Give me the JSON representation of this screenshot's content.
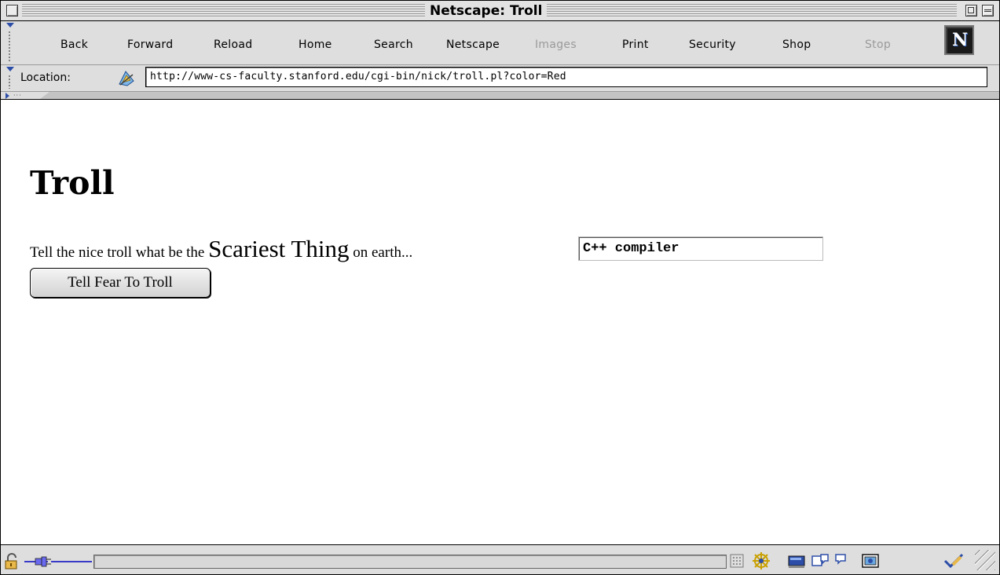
{
  "window": {
    "title": "Netscape: Troll"
  },
  "toolbar": {
    "buttons": [
      {
        "label": "Back",
        "enabled": true
      },
      {
        "label": "Forward",
        "enabled": true
      },
      {
        "label": "Reload",
        "enabled": true
      },
      {
        "label": "Home",
        "enabled": true
      },
      {
        "label": "Search",
        "enabled": true
      },
      {
        "label": "Netscape",
        "enabled": true
      },
      {
        "label": "Images",
        "enabled": false
      },
      {
        "label": "Print",
        "enabled": true
      },
      {
        "label": "Security",
        "enabled": true
      },
      {
        "label": "Shop",
        "enabled": true
      },
      {
        "label": "Stop",
        "enabled": false
      }
    ],
    "logo": "N"
  },
  "location": {
    "label": "Location:",
    "url": "http://www-cs-faculty.stanford.edu/cgi-bin/nick/troll.pl?color=Red"
  },
  "page": {
    "heading": "Troll",
    "prompt_part1": "Tell the nice troll what be the ",
    "prompt_emphasis": "Scariest Thing",
    "prompt_part2": " on earth...",
    "input_value": "C++ compiler",
    "submit_label": "Tell Fear To Troll"
  },
  "colors": {
    "accent": "#2d4ea8",
    "window_chrome": "#dedede",
    "disabled_text": "#9a9a9a"
  },
  "icons": {
    "statusbar": [
      "security-lock-icon",
      "connection-plug-icon",
      "component-bar-icon",
      "navigator-icon",
      "mail-icon",
      "composer-icon",
      "discussion-icon",
      "address-book-icon",
      "checkmark-icon"
    ]
  }
}
